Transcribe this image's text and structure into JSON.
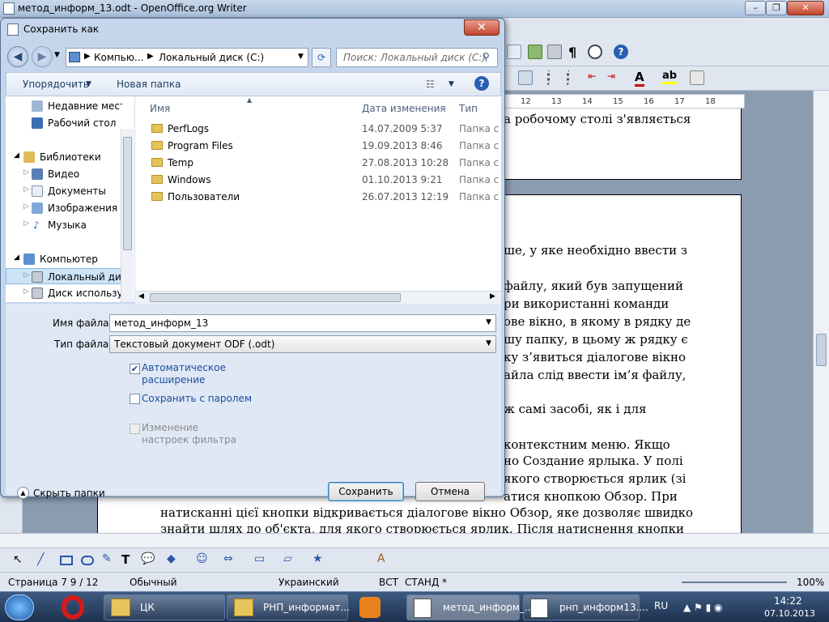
{
  "window": {
    "title": "метод_информ_13.odt - OpenOffice.org Writer"
  },
  "ruler": {
    "ticks": [
      "12",
      "13",
      "14",
      "15",
      "16",
      "17",
      "18"
    ]
  },
  "document": {
    "lines": [
      "а робочому столі з'являється",
      "ше, у яке необхідно ввести з",
      "файлу, який був запущений",
      "ри використанні команди",
      "ове вікно, в якому в рядку де",
      "шу папку, в цьому ж рядку є",
      "ку з’явиться діалогове вікно",
      "айла слід ввести ім’я файлу,",
      "ж самі засобі, як і для",
      "контекстним меню. Якщо",
      "но Создание ярлыка. У полі",
      "якого створюється ярлик (зі",
      "атися кнопкою Обзор. При",
      "натисканні цієї кнопки відкривається діалогове вікно Обзор, яке дозволяє швидко",
      "знайти шлях до об'єкта, для якого створюється ярлик. Після натиснення кнопки"
    ]
  },
  "dialog": {
    "title": "Сохранить как",
    "breadcrumb": [
      "Компью...",
      "Локальный диск (C:)"
    ],
    "search_placeholder": "Поиск: Локальный диск (C:)",
    "organize": "Упорядочить",
    "new_folder": "Новая папка",
    "nav": [
      {
        "label": "Недавние места",
        "icon": "recent-places-icon"
      },
      {
        "label": "Рабочий стол",
        "icon": "desktop-icon"
      },
      {
        "label": "Библиотеки",
        "icon": "libraries-icon"
      },
      {
        "label": "Видео",
        "icon": "video-icon"
      },
      {
        "label": "Документы",
        "icon": "documents-icon"
      },
      {
        "label": "Изображения",
        "icon": "pictures-icon"
      },
      {
        "label": "Музыка",
        "icon": "music-icon"
      },
      {
        "label": "Компьютер",
        "icon": "computer-icon"
      },
      {
        "label": "Локальный диск",
        "icon": "drive-icon"
      },
      {
        "label": "Диск используе",
        "icon": "drive-icon"
      }
    ],
    "columns": [
      "Имя",
      "Дата изменения",
      "Тип"
    ],
    "files": [
      {
        "name": "PerfLogs",
        "date": "14.07.2009 5:37",
        "type": "Папка с ф"
      },
      {
        "name": "Program Files",
        "date": "19.09.2013 8:46",
        "type": "Папка с ф"
      },
      {
        "name": "Temp",
        "date": "27.08.2013 10:28",
        "type": "Папка с ф"
      },
      {
        "name": "Windows",
        "date": "01.10.2013 9:21",
        "type": "Папка с ф"
      },
      {
        "name": "Пользователи",
        "date": "26.07.2013 12:19",
        "type": "Папка с ф"
      }
    ],
    "filename_label": "Имя файла:",
    "filename_value": "метод_информ_13",
    "filetype_label": "Тип файла:",
    "filetype_value": "Текстовый документ ODF (.odt)",
    "auto_ext_label": "Автоматическое расширение",
    "auto_ext_checked": true,
    "password_label": "Сохранить с паролем",
    "filter_label": "Изменение настроек фильтра",
    "hide_folders": "Скрыть папки",
    "save": "Сохранить",
    "cancel": "Отмена"
  },
  "status": {
    "page": "Страница  7   9 / 12",
    "style": "Обычный",
    "lang": "Украинский",
    "ins": "ВСТ",
    "std": "СТАНД",
    "star": "*",
    "zoom": "100%"
  },
  "taskbar": {
    "items": [
      {
        "label": "ЦК",
        "icon": "folder-icon"
      },
      {
        "label": "РНП_информат...",
        "icon": "folder-icon"
      },
      {
        "label": "метод_информ_...",
        "icon": "writer-icon"
      },
      {
        "label": "рнп_информ13....",
        "icon": "writer-icon"
      }
    ],
    "lang": "RU",
    "time": "14:22",
    "date": "07.10.2013"
  }
}
